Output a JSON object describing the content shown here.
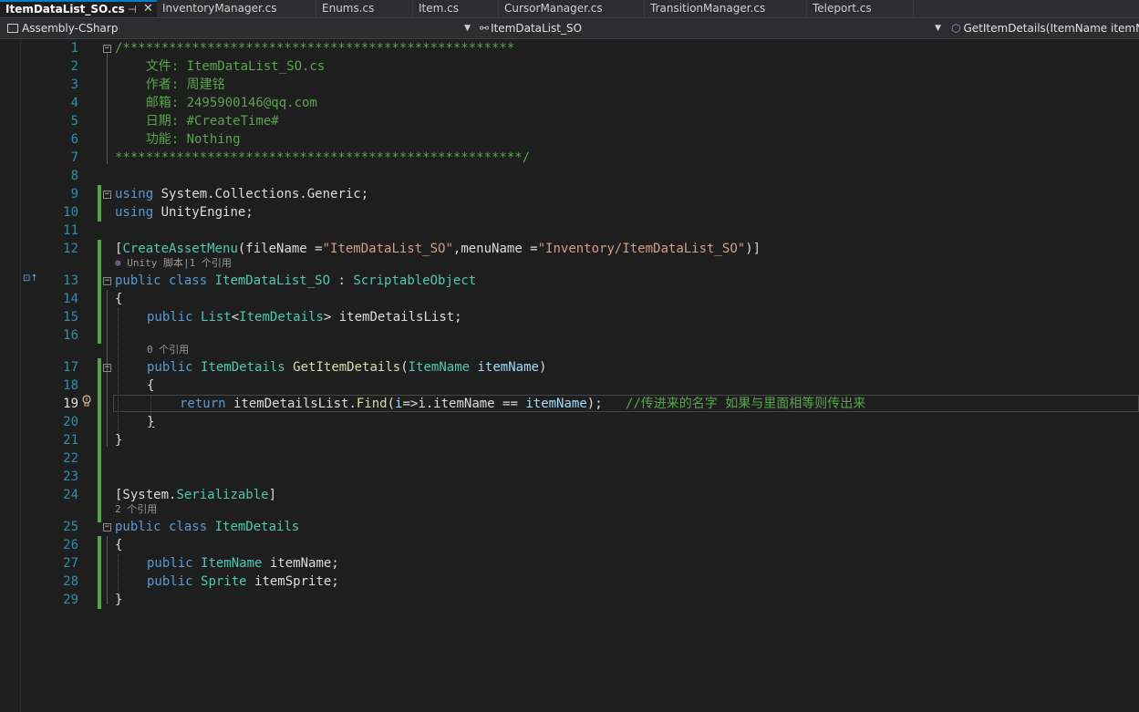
{
  "tabs": [
    {
      "label": "ItemDataList_SO.cs",
      "active": true
    },
    {
      "label": "InventoryManager.cs"
    },
    {
      "label": "Enums.cs"
    },
    {
      "label": "Item.cs"
    },
    {
      "label": "CursorManager.cs"
    },
    {
      "label": "TransitionManager.cs"
    },
    {
      "label": "Teleport.cs"
    }
  ],
  "tab_pin_icon": "pin-icon",
  "tab_close_icon": "close-icon",
  "navbar": {
    "project": "Assembly-CSharp",
    "type": "ItemDataList_SO",
    "member": "GetItemDetails(ItemName itemN"
  },
  "editor": {
    "current_line": 19,
    "line_numbers": [
      "1",
      "2",
      "3",
      "4",
      "5",
      "6",
      "7",
      "8",
      "9",
      "10",
      "11",
      "12",
      "13",
      "14",
      "15",
      "16",
      "17",
      "18",
      "19",
      "20",
      "21",
      "22",
      "23",
      "24",
      "25",
      "26",
      "27",
      "28",
      "29"
    ],
    "code": {
      "l1": "/***************************************************",
      "l2": "    文件: ItemDataList_SO.cs",
      "l3": "    作者: 周建铭",
      "l4": "    邮箱: 2495900146@qq.com",
      "l5": "    日期: #CreateTime#",
      "l6": "    功能: Nothing",
      "l7": "*****************************************************/",
      "l9_kw": "using",
      "l9_rest": " System.Collections.Generic;",
      "l10_kw": "using",
      "l10_rest": " UnityEngine;",
      "l12_a": "[",
      "l12_attr": "CreateAssetMenu",
      "l12_b": "(fileName =",
      "l12_s1": "\"ItemDataList_SO\"",
      "l12_c": ",menuName =",
      "l12_s2": "\"Inventory/ItemDataList_SO\"",
      "l12_d": ")]",
      "l13_kw": "public class",
      "l13_name": "ItemDataList_SO",
      "l13_sep": " : ",
      "l13_base": "ScriptableObject",
      "l14": "{",
      "l15_kw": "public",
      "l15_type": "List",
      "l15_lt": "<",
      "l15_arg": "ItemDetails",
      "l15_rest": "> itemDetailsList;",
      "l17_kw": "public",
      "l17_type": "ItemDetails",
      "l17_fn": "GetItemDetails",
      "l17_p1": "(",
      "l17_ptype": "ItemName",
      "l17_pname": "itemName",
      "l17_p2": ")",
      "l18": "{",
      "l19_kw": "return",
      "l19_a": " itemDetailsList.",
      "l19_fn": "Find",
      "l19_b": "(",
      "l19_lam": "i",
      "l19_c": "=>",
      "l19_d": "i.itemName == ",
      "l19_var": "itemName",
      "l19_e": ");   ",
      "l19_com": "//传进来的名字 如果与里面相等则传出来",
      "l20": "}",
      "l21": "}",
      "l24_a": "[System.",
      "l24_type": "Serializable",
      "l24_b": "]",
      "l25_kw": "public class",
      "l25_name": "ItemDetails",
      "l26": "{",
      "l27_kw": "public",
      "l27_type": "ItemName",
      "l27_rest": " itemName;",
      "l28_kw": "public",
      "l28_type": "Sprite",
      "l28_rest": " itemSprite;",
      "l29": "}"
    },
    "hints": {
      "h13": "Unity 脚本|1 个引用",
      "h17": "0 个引用",
      "h25": "2 个引用"
    }
  }
}
